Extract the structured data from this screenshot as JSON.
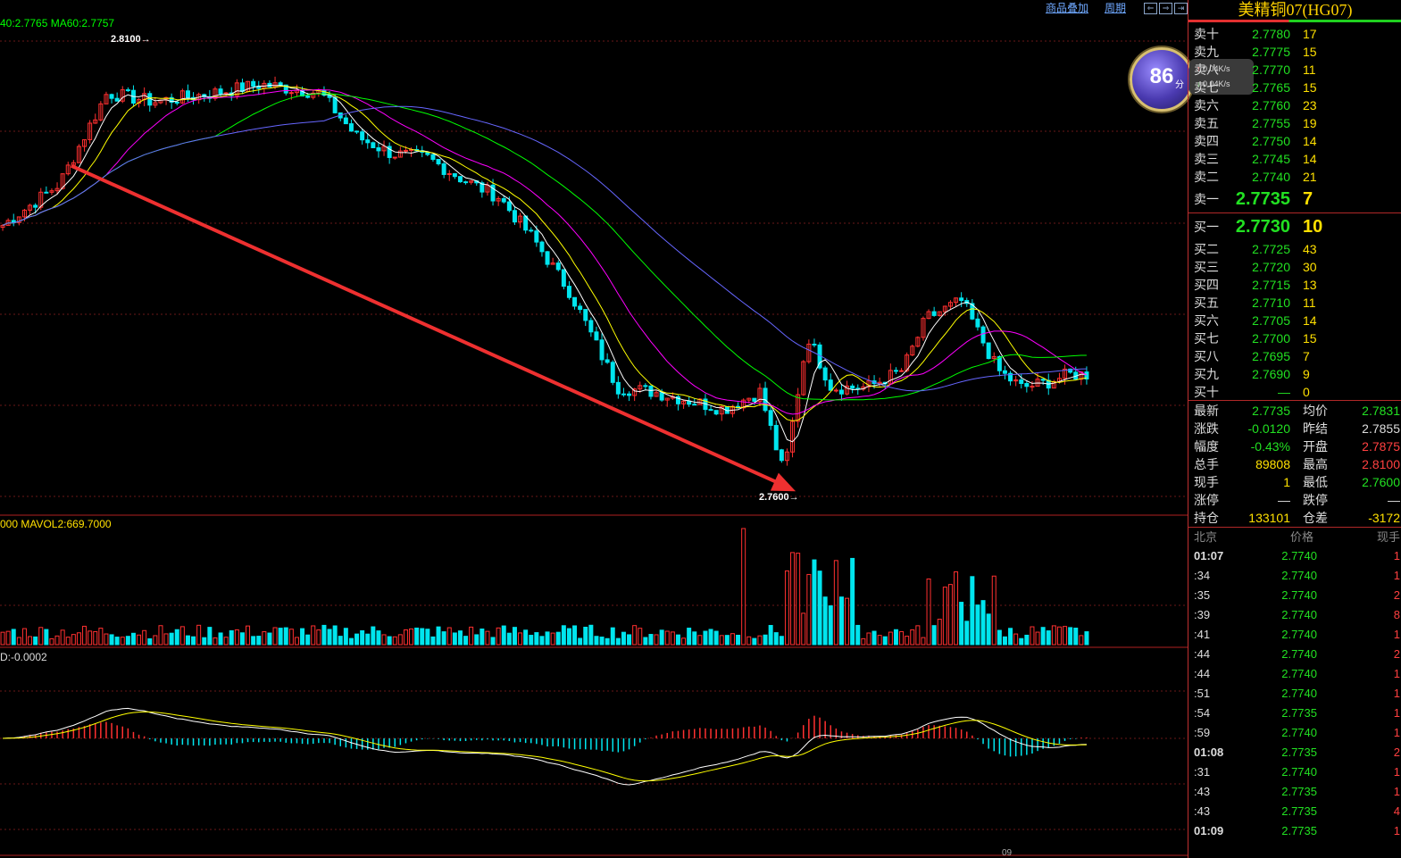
{
  "header": {
    "overlay_label": "商品叠加",
    "period_label": "周期",
    "ma_legend": "40:2.7765  MA60:2.7757",
    "vol_legend": "000  MAVOL2:669.7000",
    "macd_legend": "D:-0.0002",
    "time_label": "09"
  },
  "annotations": {
    "high": "2.8100→",
    "low": "2.7600→"
  },
  "colors": {
    "up": "#ff3030",
    "down": "#00e5ee",
    "ma5": "#ffffff",
    "ma10": "#ffff00",
    "ma20": "#ff00ff",
    "ma40": "#00ff00",
    "ma60": "#6666ff",
    "trend": "#ee3030"
  },
  "chart_data": {
    "type": "candlestick",
    "annotations": [
      {
        "label": "2.8100",
        "type": "high"
      },
      {
        "label": "2.7600",
        "type": "low"
      }
    ],
    "trend_arrow": {
      "from": [
        0.06,
        2.7976
      ],
      "to": [
        0.67,
        2.76
      ]
    },
    "x": [
      0.0,
      0.05,
      0.09,
      0.13,
      0.18,
      0.22,
      0.27,
      0.3,
      0.33,
      0.36,
      0.39,
      0.42,
      0.45,
      0.48,
      0.52,
      0.55,
      0.58,
      0.61,
      0.64,
      0.66,
      0.68,
      0.7,
      0.73,
      0.76,
      0.78,
      0.81,
      0.84,
      0.86,
      0.88,
      0.9
    ],
    "close": [
      2.7905,
      2.7955,
      2.806,
      2.805,
      2.806,
      2.807,
      2.806,
      2.801,
      2.799,
      2.7985,
      2.796,
      2.794,
      2.789,
      2.783,
      2.772,
      2.7715,
      2.7705,
      2.7695,
      2.7715,
      2.762,
      2.778,
      2.772,
      2.772,
      2.774,
      2.78,
      2.782,
      2.774,
      2.772,
      2.7725,
      2.7735
    ],
    "ylim": [
      2.759,
      2.812
    ]
  },
  "orderbook": {
    "title": "美精铜07(HG07)",
    "asks": [
      {
        "label": "卖十",
        "price": "2.7780",
        "vol": "17"
      },
      {
        "label": "卖九",
        "price": "2.7775",
        "vol": "15"
      },
      {
        "label": "卖八",
        "price": "2.7770",
        "vol": "11"
      },
      {
        "label": "卖七",
        "price": "2.7765",
        "vol": "15"
      },
      {
        "label": "卖六",
        "price": "2.7760",
        "vol": "23"
      },
      {
        "label": "卖五",
        "price": "2.7755",
        "vol": "19"
      },
      {
        "label": "卖四",
        "price": "2.7750",
        "vol": "14"
      },
      {
        "label": "卖三",
        "price": "2.7745",
        "vol": "14"
      },
      {
        "label": "卖二",
        "price": "2.7740",
        "vol": "21"
      },
      {
        "label": "卖一",
        "price": "2.7735",
        "vol": "7"
      }
    ],
    "bids": [
      {
        "label": "买一",
        "price": "2.7730",
        "vol": "10"
      },
      {
        "label": "买二",
        "price": "2.7725",
        "vol": "43"
      },
      {
        "label": "买三",
        "price": "2.7720",
        "vol": "30"
      },
      {
        "label": "买四",
        "price": "2.7715",
        "vol": "13"
      },
      {
        "label": "买五",
        "price": "2.7710",
        "vol": "11"
      },
      {
        "label": "买六",
        "price": "2.7705",
        "vol": "14"
      },
      {
        "label": "买七",
        "price": "2.7700",
        "vol": "15"
      },
      {
        "label": "买八",
        "price": "2.7695",
        "vol": "7"
      },
      {
        "label": "买九",
        "price": "2.7690",
        "vol": "9"
      },
      {
        "label": "买十",
        "price": "—",
        "vol": "0"
      }
    ]
  },
  "stats": [
    {
      "l1": "最新",
      "v1": "2.7735",
      "c1": "#22e022",
      "l2": "均价",
      "v2": "2.7831",
      "c2": "#22e022"
    },
    {
      "l1": "涨跌",
      "v1": "-0.0120",
      "c1": "#22e022",
      "l2": "昨结",
      "v2": "2.7855",
      "c2": "#dddddd"
    },
    {
      "l1": "幅度",
      "v1": "-0.43%",
      "c1": "#22e022",
      "l2": "开盘",
      "v2": "2.7875",
      "c2": "#ff4040"
    },
    {
      "l1": "总手",
      "v1": "89808",
      "c1": "#ffe000",
      "l2": "最高",
      "v2": "2.8100",
      "c2": "#ff4040"
    },
    {
      "l1": "现手",
      "v1": "1",
      "c1": "#ffe000",
      "l2": "最低",
      "v2": "2.7600",
      "c2": "#22e022"
    },
    {
      "l1": "涨停",
      "v1": "—",
      "c1": "#dddddd",
      "l2": "跌停",
      "v2": "—",
      "c2": "#dddddd"
    },
    {
      "l1": "持仓",
      "v1": "133101",
      "c1": "#ffe000",
      "l2": "仓差",
      "v2": "-3172",
      "c2": "#ffe000"
    }
  ],
  "ticks": {
    "header": {
      "time": "北京",
      "price": "价格",
      "vol": "现手"
    },
    "rows": [
      {
        "time": "01:07",
        "price": "2.7740",
        "vol": "1"
      },
      {
        "time": ":34",
        "price": "2.7740",
        "vol": "1"
      },
      {
        "time": ":35",
        "price": "2.7740",
        "vol": "2"
      },
      {
        "time": ":39",
        "price": "2.7740",
        "vol": "8"
      },
      {
        "time": ":41",
        "price": "2.7740",
        "vol": "1"
      },
      {
        "time": ":44",
        "price": "2.7740",
        "vol": "2"
      },
      {
        "time": ":44",
        "price": "2.7740",
        "vol": "1"
      },
      {
        "time": ":51",
        "price": "2.7740",
        "vol": "1"
      },
      {
        "time": ":54",
        "price": "2.7735",
        "vol": "1"
      },
      {
        "time": ":59",
        "price": "2.7740",
        "vol": "1"
      },
      {
        "time": "01:08",
        "price": "2.7735",
        "vol": "2"
      },
      {
        "time": ":31",
        "price": "2.7740",
        "vol": "1"
      },
      {
        "time": ":43",
        "price": "2.7735",
        "vol": "1"
      },
      {
        "time": ":43",
        "price": "2.7735",
        "vol": "4"
      },
      {
        "time": "01:09",
        "price": "2.7735",
        "vol": "1"
      }
    ]
  },
  "score": {
    "value": "86",
    "unit": "分"
  },
  "speed": {
    "up": "0.04K/s",
    "down": "0.04K/s"
  }
}
